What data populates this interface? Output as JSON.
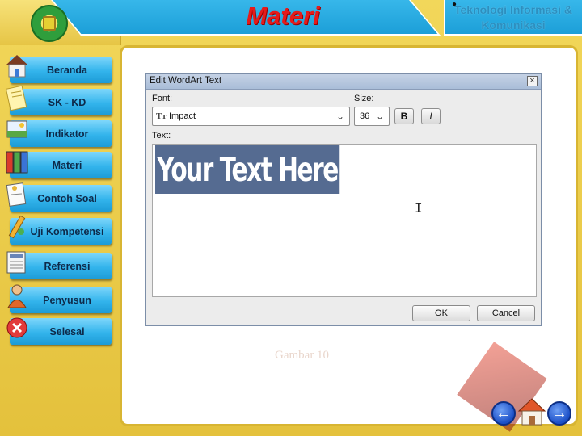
{
  "header": {
    "title": "Materi",
    "subject": "Teknologi Informasi & Komunikasi"
  },
  "sidebar": {
    "items": [
      {
        "label": "Beranda",
        "icon": "house-icon"
      },
      {
        "label": "SK - KD",
        "icon": "document-icon"
      },
      {
        "label": "Indikator",
        "icon": "picture-icon"
      },
      {
        "label": "Materi",
        "icon": "binders-icon"
      },
      {
        "label": "Contoh Soal",
        "icon": "paper-icon"
      },
      {
        "label": "Uji Kompetensi",
        "icon": "pencil-icon"
      },
      {
        "label": "Referensi",
        "icon": "newspaper-icon"
      },
      {
        "label": "Penyusun",
        "icon": "person-icon"
      },
      {
        "label": "Selesai",
        "icon": "close-icon"
      }
    ]
  },
  "dialog": {
    "title": "Edit WordArt Text",
    "font_label": "Font:",
    "font_value": "Impact",
    "size_label": "Size:",
    "size_value": "36",
    "bold_label": "B",
    "italic_label": "I",
    "text_label": "Text:",
    "text_value": "Your Text Here",
    "ok_label": "OK",
    "cancel_label": "Cancel"
  },
  "caption": "Gambar 10",
  "colors": {
    "frame": "#e8c846",
    "title_bar": "#1c9fd8",
    "title_text": "#e51b1b",
    "selection": "#556b91"
  }
}
